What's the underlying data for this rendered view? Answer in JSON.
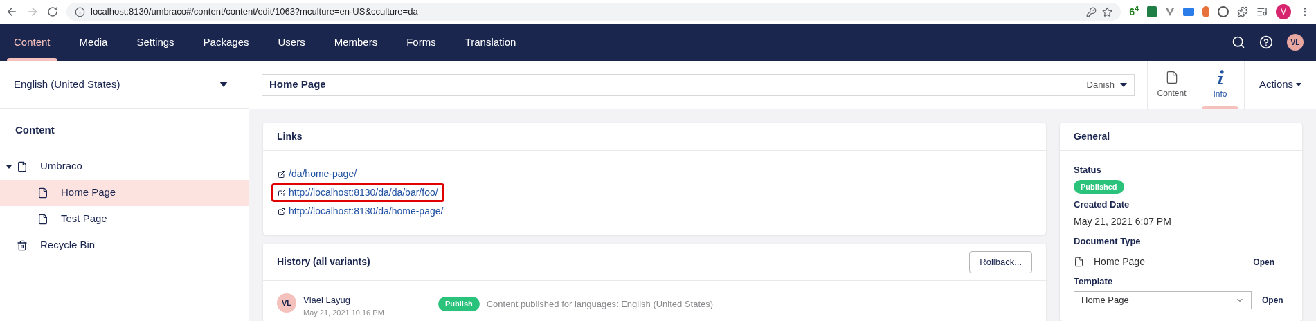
{
  "browser": {
    "url": "localhost:8130/umbraco#/content/content/edit/1063?mculture=en-US&cculture=da",
    "extension_badge": "6$^{4}$",
    "profile": "V"
  },
  "nav": {
    "items": [
      {
        "label": "Content",
        "selected": true
      },
      {
        "label": "Media",
        "selected": false
      },
      {
        "label": "Settings",
        "selected": false
      },
      {
        "label": "Packages",
        "selected": false
      },
      {
        "label": "Users",
        "selected": false
      },
      {
        "label": "Members",
        "selected": false
      },
      {
        "label": "Forms",
        "selected": false
      },
      {
        "label": "Translation",
        "selected": false
      }
    ],
    "avatar": "VL"
  },
  "sidebar": {
    "language": "English (United States)",
    "title": "Content",
    "tree": [
      {
        "label": "Umbraco",
        "kind": "page",
        "expanded": true,
        "selected": false,
        "children": [
          {
            "label": "Home Page",
            "kind": "page",
            "selected": true
          },
          {
            "label": "Test Page",
            "kind": "page",
            "selected": false
          }
        ]
      },
      {
        "label": "Recycle Bin",
        "kind": "bin",
        "selected": false
      }
    ]
  },
  "header": {
    "name": "Home Page",
    "culture": "Danish",
    "apps": [
      {
        "label": "Content",
        "kind": "document",
        "selected": false
      },
      {
        "label": "Info",
        "kind": "info",
        "selected": true
      }
    ],
    "actions": "Actions"
  },
  "links": {
    "title": "Links",
    "items": [
      {
        "url": "/da/home-page/",
        "highlighted": false
      },
      {
        "url": "http://localhost:8130/da/da/bar/foo/",
        "highlighted": true
      },
      {
        "url": "http://localhost:8130/da/home-page/",
        "highlighted": false
      }
    ]
  },
  "history": {
    "title": "History (all variants)",
    "rollback": "Rollback...",
    "entries": [
      {
        "avatar": "VL",
        "user": "Vlael Layug",
        "date": "May 21, 2021 10:16 PM",
        "action": "Publish",
        "message": "Content published for languages: English (United States)"
      }
    ]
  },
  "general": {
    "title": "General",
    "status_label": "Status",
    "status": "Published",
    "created_label": "Created Date",
    "created": "May 21, 2021 6:07 PM",
    "doctype_label": "Document Type",
    "doctype": "Home Page",
    "doctype_open": "Open",
    "template_label": "Template",
    "template": "Home Page",
    "template_open": "Open"
  }
}
